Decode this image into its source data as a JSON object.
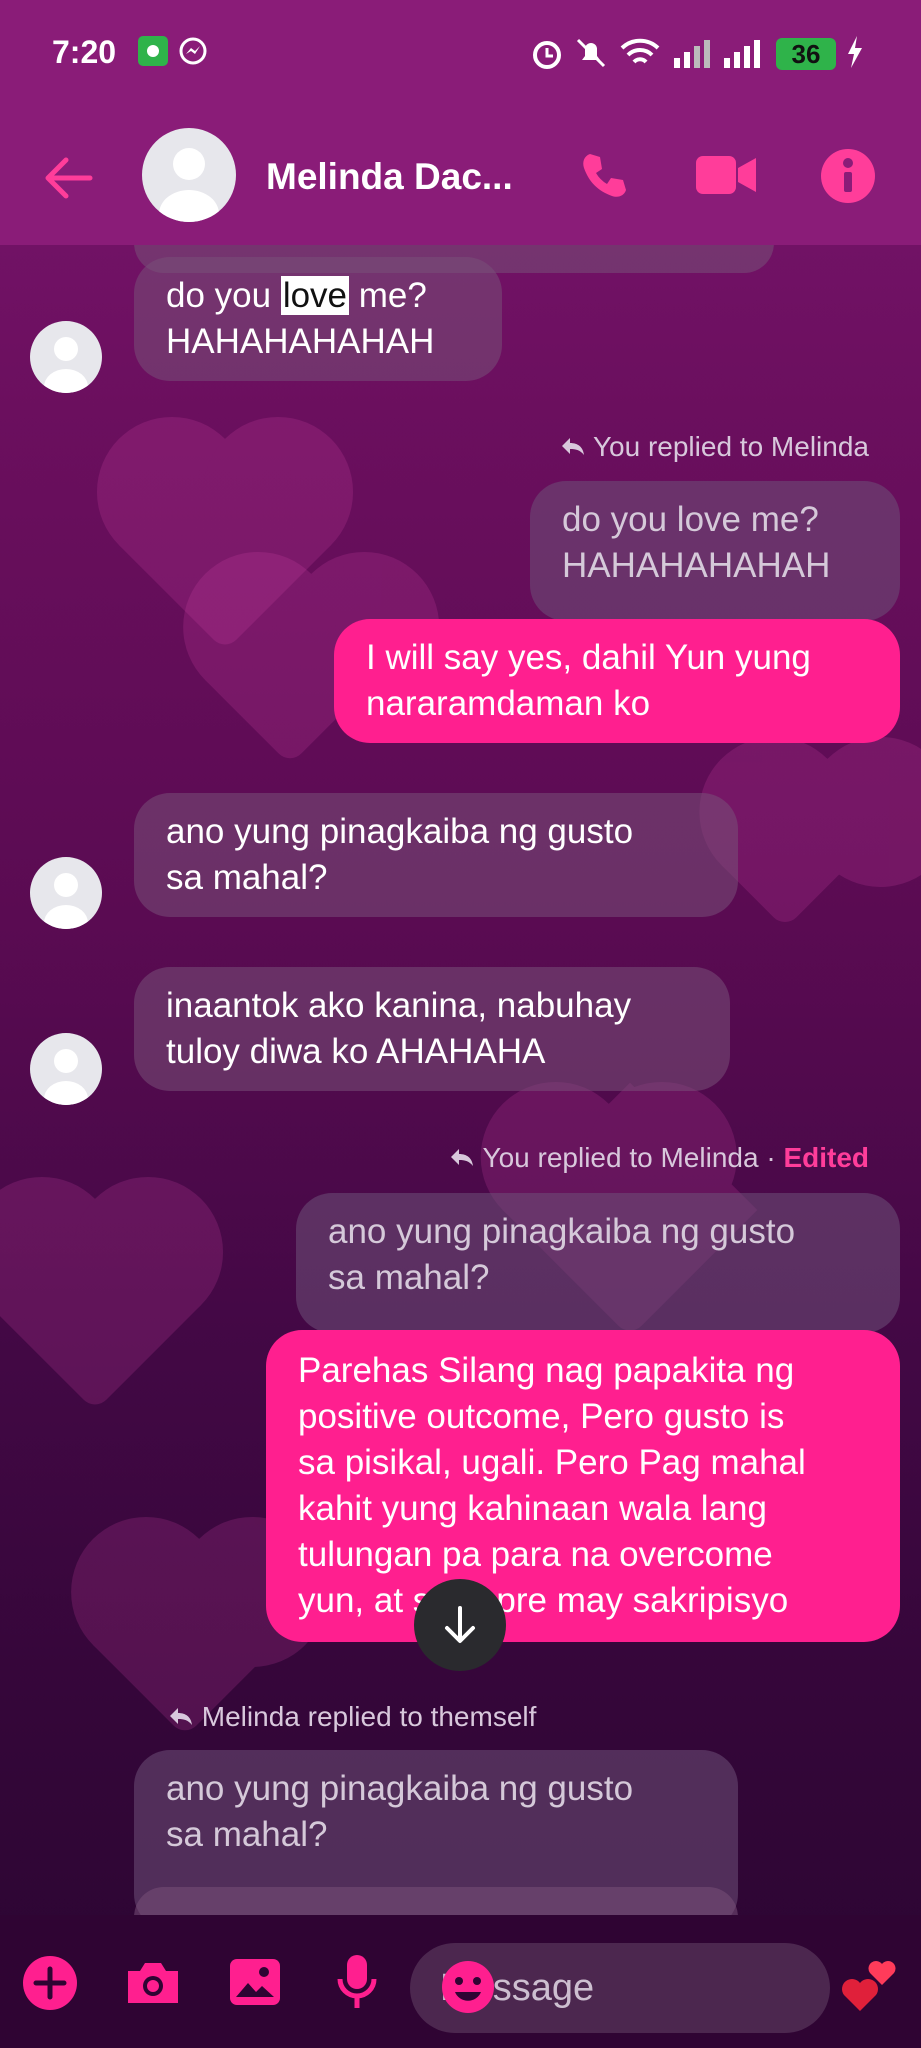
{
  "status_bar": {
    "time": "7:20",
    "battery": "36"
  },
  "header": {
    "contact_name": "Melinda Dac..."
  },
  "messages": {
    "m1_line1_pre": "do you ",
    "m1_line1_hl": "love",
    "m1_line1_post": " me?",
    "m1_line2": "HAHAHAHAHAH",
    "reply1_label": "You replied to Melinda",
    "q1_line1": "do you love me?",
    "q1_line2": "HAHAHAHAHAH",
    "o1_line1": "I will say yes, dahil Yun yung",
    "o1_line2": "nararamdaman ko",
    "i2_line1": "ano yung pinagkaiba ng gusto",
    "i2_line2": "sa mahal?",
    "i3_line1": "inaantok ako kanina, nabuhay",
    "i3_line2": "tuloy diwa ko AHAHAHA",
    "reply2_label": "You replied to Melinda",
    "reply2_sep": " · ",
    "reply2_edited": "Edited",
    "q2_line1": "ano yung pinagkaiba ng gusto",
    "q2_line2": "sa mahal?",
    "o2_lines": [
      "Parehas Silang nag papakita ng",
      "positive outcome, Pero gusto is",
      "sa pisikal, ugali. Pero Pag mahal",
      "kahit yung kahinaan wala lang",
      "tulungan pa para na overcome",
      "yun, at syempre may sakripisyo"
    ],
    "reply3_label": "Melinda replied to themself",
    "q3_line1": "ano yung pinagkaiba ng gusto",
    "q3_line2": "sa mahal?"
  },
  "composer": {
    "placeholder": "Message"
  },
  "colors": {
    "accent": "#ff1f8f",
    "header_bg": "#8a1c78"
  }
}
